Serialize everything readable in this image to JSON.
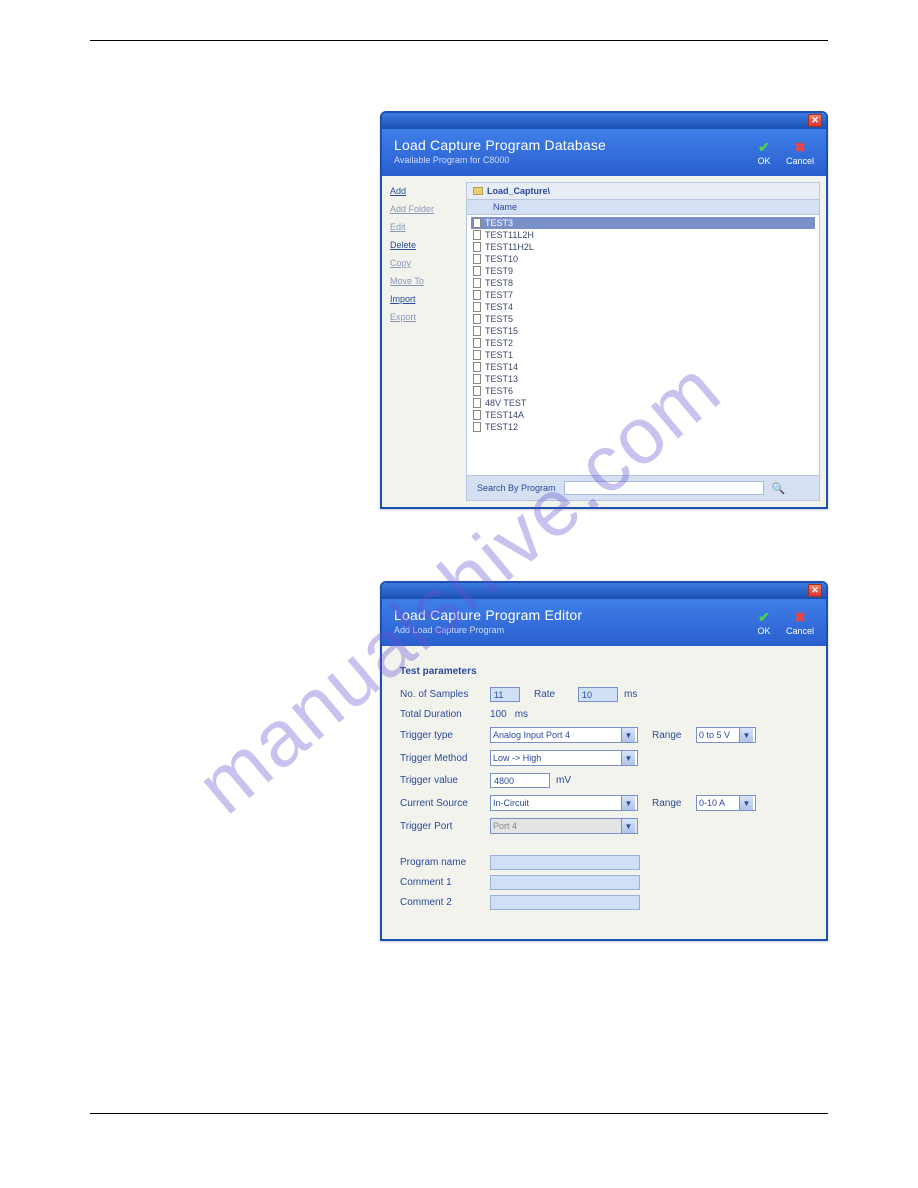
{
  "watermark": "manualshive.com",
  "window1": {
    "title": "Load Capture Program Database",
    "subtitle": "Available Program for C8000",
    "ok_label": "OK",
    "cancel_label": "Cancel",
    "close_symbol": "✕",
    "sidebar": {
      "add": "Add",
      "add_folder": "Add Folder",
      "edit": "Edit",
      "delete": "Delete",
      "copy": "Copy",
      "move_to": "Move To",
      "import": "Import",
      "export": "Export"
    },
    "path_label": "Load_Capture\\",
    "column_header": "Name",
    "items": [
      "TEST3",
      "TEST11L2H",
      "TEST11H2L",
      "TEST10",
      "TEST9",
      "TEST8",
      "TEST7",
      "TEST4",
      "TEST5",
      "TEST15",
      "TEST2",
      "TEST1",
      "TEST14",
      "TEST13",
      "TEST6",
      "48V TEST",
      "TEST14A",
      "TEST12"
    ],
    "search_label": "Search By Program",
    "search_value": ""
  },
  "window2": {
    "title": "Load Capture Program Editor",
    "subtitle": "Add Load Capture Program",
    "ok_label": "OK",
    "cancel_label": "Cancel",
    "close_symbol": "✕",
    "section_title": "Test parameters",
    "labels": {
      "no_samples": "No. of Samples",
      "rate": "Rate",
      "rate_unit": "ms",
      "total_duration": "Total Duration",
      "duration_value": "100",
      "duration_unit": "ms",
      "trigger_type": "Trigger type",
      "range": "Range",
      "trigger_method": "Trigger Method",
      "trigger_value": "Trigger value",
      "trigger_value_unit": "mV",
      "current_source": "Current Source",
      "trigger_port": "Trigger Port",
      "program_name": "Program name",
      "comment1": "Comment 1",
      "comment2": "Comment 2"
    },
    "values": {
      "no_samples": "11",
      "rate": "10",
      "trigger_type": "Analog Input Port 4",
      "trigger_range": "0 to 5 V",
      "trigger_method": "Low -> High",
      "trigger_value": "4800",
      "current_source": "In-Circuit",
      "current_range": "0-10 A",
      "trigger_port": "Port 4",
      "program_name": "",
      "comment1": "",
      "comment2": ""
    }
  }
}
